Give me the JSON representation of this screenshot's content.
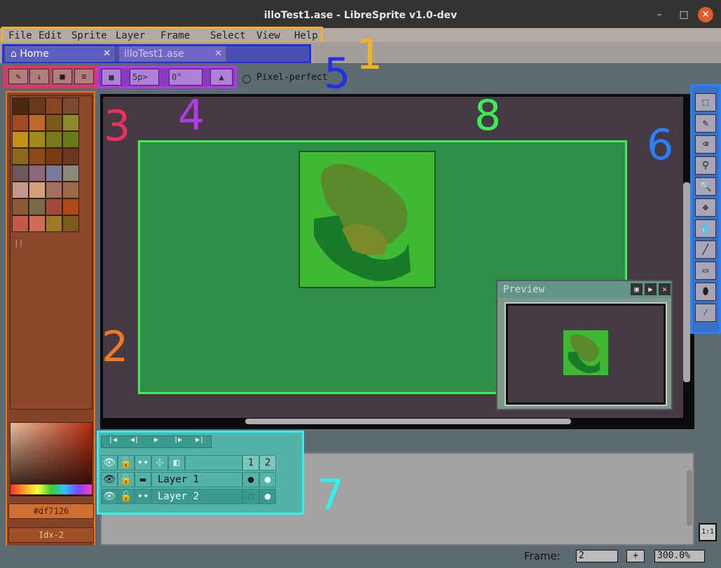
{
  "window": {
    "title": "illoTest1.ase - LibreSprite v1.0-dev",
    "minimize": "–",
    "maximize": "□",
    "close": "✕"
  },
  "menu": [
    "File",
    "Edit",
    "Sprite",
    "Layer",
    "Frame",
    "Select",
    "View",
    "Help"
  ],
  "tabs": [
    {
      "label": "Home",
      "close": "✕",
      "icon": "home-icon"
    },
    {
      "label": "illoTest1.ase",
      "close": "✕"
    }
  ],
  "toolbar": {
    "left_buttons": [
      "✎",
      "↓",
      "■",
      "≡"
    ],
    "stop_label": "■",
    "spacing_value": "5p>",
    "angle_value": "0°",
    "ink_label": "▲",
    "pixel_perfect_label": "Pixel-perfect",
    "pixel_perfect_checked": false
  },
  "palette": {
    "colors": [
      "#4a2a14",
      "#6b3a1c",
      "#8a4424",
      "#7a4a30",
      "#a24a22",
      "#c0692a",
      "#7a5a1a",
      "#8a8a2a",
      "#c09018",
      "#a28a1a",
      "#7a7a1a",
      "#6a7a1a",
      "#8a6a1a",
      "#8a4a1a",
      "#7a3a14",
      "#6a3a20",
      "#6a5a5a",
      "#8a6a7a",
      "#7a7a9a",
      "#8a8a7a",
      "#c09a8a",
      "#d4a07a",
      "#a07060",
      "#9a6a4a",
      "#8a5a3a",
      "#7a6a4a",
      "#a04a3a",
      "#b04a1a",
      "#c05a4a",
      "#d06a5a",
      "#9a7a2a",
      "#7a5a1a"
    ],
    "count_label": "||",
    "fg_hex": "#df7126",
    "index_label": "Idx-2"
  },
  "preview": {
    "title": "Preview",
    "buttons": [
      "▣",
      "▶",
      "✕"
    ]
  },
  "tools": [
    {
      "name": "rectangular-marquee-icon",
      "glyph": "⬚"
    },
    {
      "name": "pencil-icon",
      "glyph": "✎"
    },
    {
      "name": "eraser-icon",
      "glyph": "⌫"
    },
    {
      "name": "eyedropper-icon",
      "glyph": "⚲"
    },
    {
      "name": "zoom-icon",
      "glyph": "🔍"
    },
    {
      "name": "move-icon",
      "glyph": "✥"
    },
    {
      "name": "paint-bucket-icon",
      "glyph": "💧"
    },
    {
      "name": "line-icon",
      "glyph": "╱"
    },
    {
      "name": "rectangle-icon",
      "glyph": "▭"
    },
    {
      "name": "contour-icon",
      "glyph": "⬮"
    },
    {
      "name": "spray-icon",
      "glyph": "⁄"
    }
  ],
  "timeline": {
    "nav_buttons": [
      "|◀",
      "◀|",
      "▶",
      "|▶",
      "▶|"
    ],
    "header_icons": [
      "👁",
      "🔓",
      "••",
      "⊹",
      "◧"
    ],
    "frames": [
      "1",
      "2"
    ],
    "layers": [
      {
        "name": "Layer 1",
        "visible": "👁",
        "lock": "🔓",
        "link": "▬"
      },
      {
        "name": "Layer 2",
        "visible": "👁",
        "lock": "🔓",
        "link": "••"
      }
    ]
  },
  "zoom_button": "1:1",
  "status": {
    "frame_label": "Frame:",
    "frame_value": "2",
    "add_frame": "+",
    "zoom_value": "300.0%"
  },
  "annotations": [
    {
      "num": "1",
      "color": "#f5b21f"
    },
    {
      "num": "2",
      "color": "#f07a1f"
    },
    {
      "num": "3",
      "color": "#ef2f5f"
    },
    {
      "num": "4",
      "color": "#b23ae8"
    },
    {
      "num": "5",
      "color": "#2030e8"
    },
    {
      "num": "6",
      "color": "#2a80ff"
    },
    {
      "num": "7",
      "color": "#2ef2f2"
    },
    {
      "num": "8",
      "color": "#3aef55"
    }
  ]
}
